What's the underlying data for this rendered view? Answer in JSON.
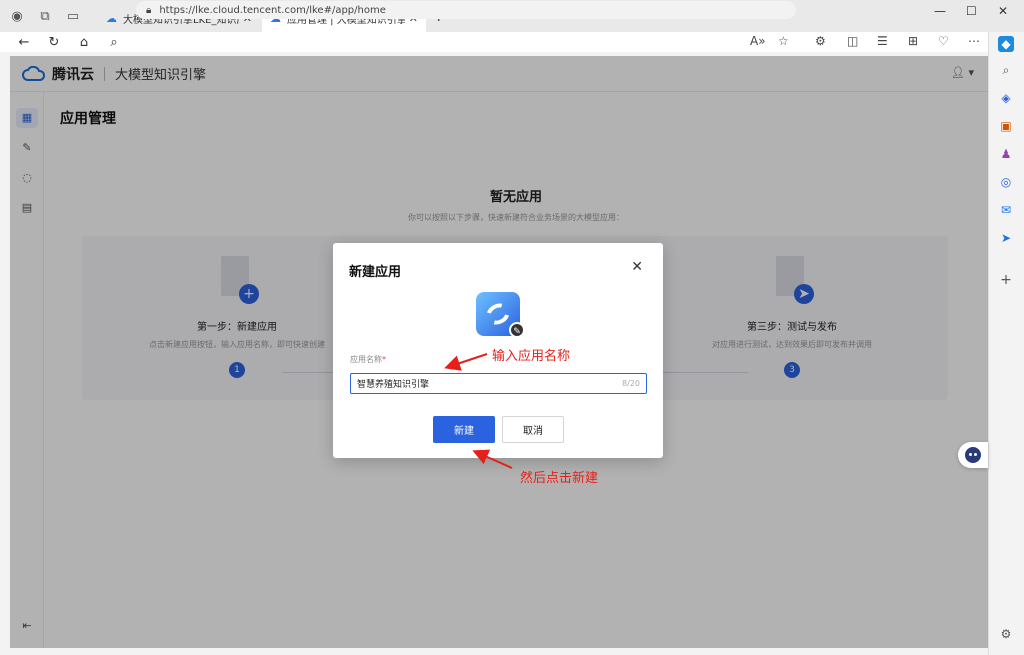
{
  "browser": {
    "tabs": [
      {
        "label": "大模型知识引擎LKE_知识应用搭"
      },
      {
        "label": "应用管理 | 大模型知识引擎"
      }
    ],
    "url": "https://lke.cloud.tencent.com/lke#/app/home",
    "win_controls": {
      "minimize": "—",
      "maximize": "☐",
      "close": "✕"
    }
  },
  "app": {
    "brand": "腾讯云",
    "product": "大模型知识引擎",
    "page_title": "应用管理",
    "empty_title": "暂无应用",
    "empty_subtitle": "你可以按照以下步骤，快速新建符合业务场景的大模型应用：",
    "steps": [
      {
        "num": "1",
        "title": "第一步：新建应用",
        "desc": "点击新建应用按钮，输入应用名称，即可快速创建"
      },
      {
        "num": "3",
        "title": "第三步：测试与发布",
        "desc": "对应用进行测试，达到效果后即可发布并调用"
      }
    ]
  },
  "dialog": {
    "title": "新建应用",
    "field_label": "应用名称",
    "required_mark": "*",
    "input_value": "智慧养殖知识引擎",
    "char_count": "8/20",
    "primary_button": "新建",
    "cancel_button": "取消"
  },
  "annotations": {
    "input_hint": "输入应用名称",
    "click_hint": "然后点击新建"
  },
  "colors": {
    "primary": "#2b62e0",
    "annotation": "#e5201a"
  }
}
